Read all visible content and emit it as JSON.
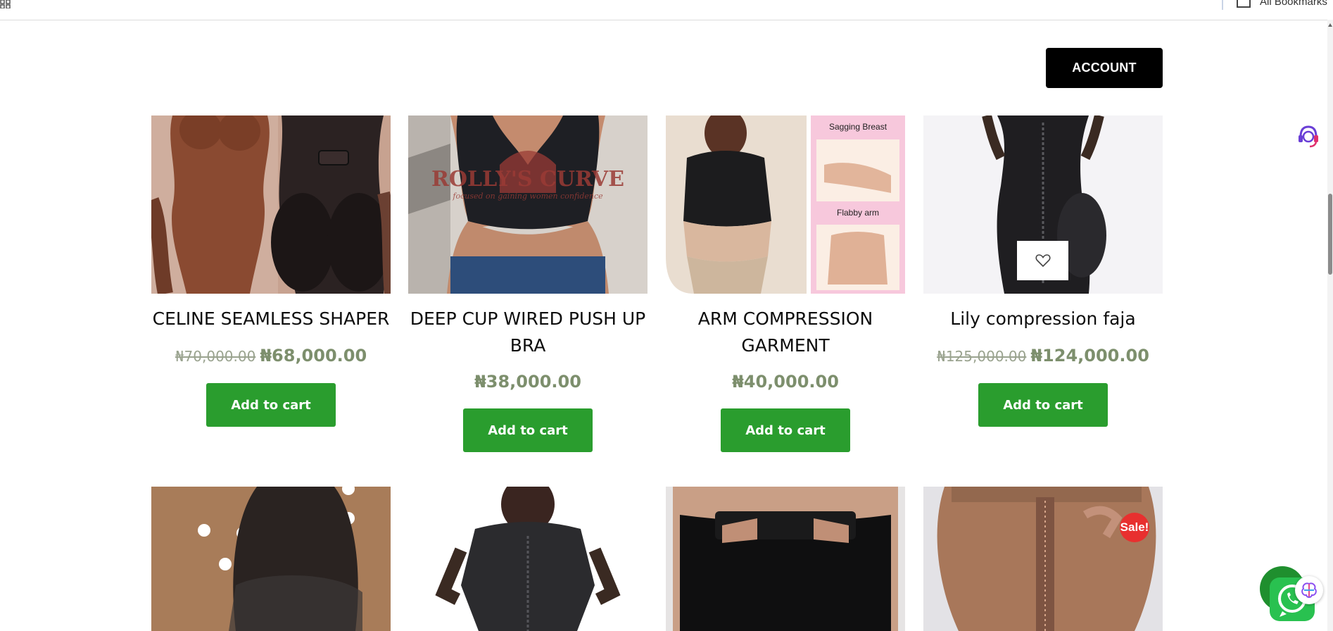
{
  "browser": {
    "bookmarks_label": "All Bookmarks"
  },
  "header": {
    "account_label": "ACCOUNT"
  },
  "products": [
    {
      "name": "CELINE SEAMLESS SHAPER",
      "old_price": "₦70,000.00",
      "price": "₦68,000.00",
      "cart_label": "Add to cart"
    },
    {
      "name_line1": "DEEP CUP WIRED PUSH UP",
      "name_line2": "BRA",
      "price": "₦38,000.00",
      "cart_label": "Add to cart",
      "image_text_1": "ROLLY'S CURVE",
      "image_text_2": "focused on gaining women confidence"
    },
    {
      "name_line1": "ARM COMPRESSION",
      "name_line2": "GARMENT",
      "price": "₦40,000.00",
      "cart_label": "Add to cart",
      "image_text_1": "Sagging Breast",
      "image_text_2": "Flabby arm"
    },
    {
      "name": "Lily compression faja",
      "old_price": "₦125,000.00",
      "price": "₦124,000.00",
      "cart_label": "Add to cart"
    }
  ],
  "second_row": {
    "sale_badge": "Sale!"
  },
  "colors": {
    "cart_button": "#2a9d2e",
    "price": "#7d8f6d",
    "account_button": "#000000",
    "sale_badge": "#e8302f"
  },
  "icons": [
    "apps-icon",
    "bookmark-folder-icon",
    "heart-icon",
    "support-agent-icon",
    "whatsapp-icon",
    "ai-brain-icon"
  ]
}
